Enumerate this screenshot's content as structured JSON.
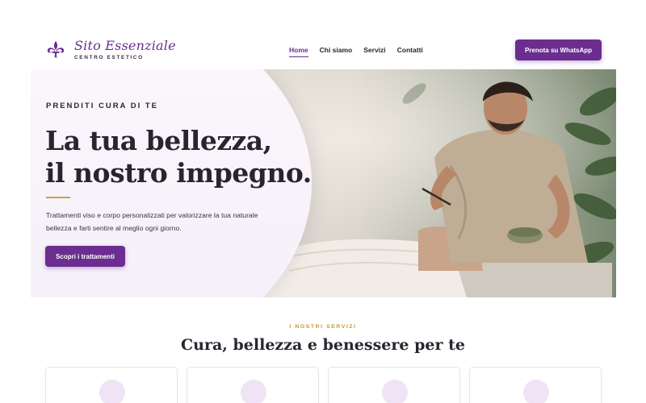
{
  "brand": {
    "title": "Sito Essenziale",
    "subtitle": "CENTRO ESTETICO",
    "logo_icon": "fleur-de-lis-icon",
    "color": "#6b2d8f"
  },
  "nav": {
    "items": [
      {
        "label": "Home",
        "active": true
      },
      {
        "label": "Chi siamo",
        "active": false
      },
      {
        "label": "Servizi",
        "active": false
      },
      {
        "label": "Contatti",
        "active": false
      }
    ],
    "cta_label": "Prenota su WhatsApp"
  },
  "hero": {
    "eyebrow": "PRENDITI CURA DI TE",
    "title_line1": "La tua bellezza,",
    "title_line2": "il nostro impegno.",
    "description": "Trattamenti viso e corpo personalizzati per valorizzare la tua naturale bellezza e farti sentire al meglio ogni giorno.",
    "button_label": "Scopri i trattamenti",
    "accent_color": "#c9a04a"
  },
  "services": {
    "eyebrow": "I NOSTRI SERVIZI",
    "title": "Cura, bellezza e benessere per te",
    "cards": [
      {
        "icon": "service-icon"
      },
      {
        "icon": "service-icon"
      },
      {
        "icon": "service-icon"
      },
      {
        "icon": "service-icon"
      }
    ]
  }
}
